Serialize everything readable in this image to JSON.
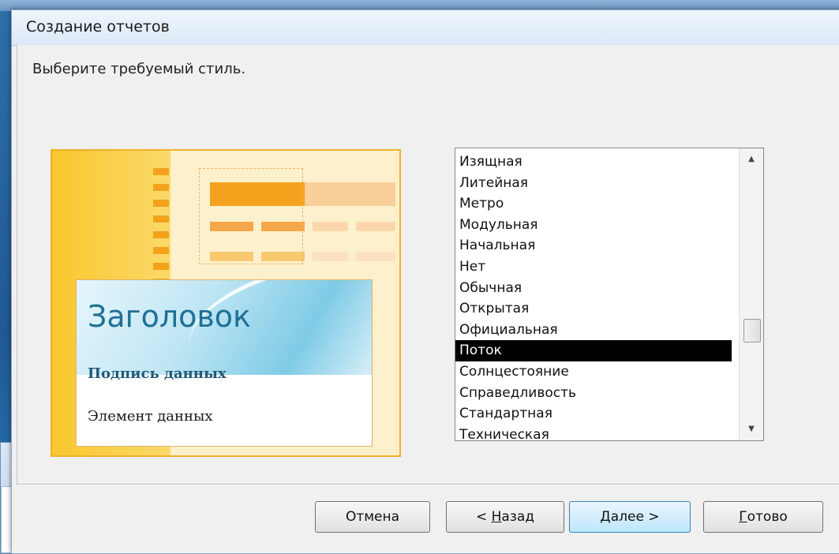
{
  "dialog": {
    "title": "Создание отчетов",
    "prompt": "Выберите требуемый стиль."
  },
  "preview": {
    "heading": "Заголовок",
    "caption": "Подпись данных",
    "item": "Элемент данных"
  },
  "style_list": {
    "items": [
      "Изящная",
      "Литейная",
      "Метро",
      "Модульная",
      "Начальная",
      "Нет",
      "Обычная",
      "Открытая",
      "Официальная",
      "Поток",
      "Солнцестояние",
      "Справедливость",
      "Стандартная",
      "Техническая"
    ],
    "selected": "Поток"
  },
  "buttons": {
    "cancel": "Отмена",
    "back_pre": "< ",
    "back_key": "Н",
    "back_post": "азад",
    "next_key": "Д",
    "next_post": "алее >",
    "finish_key": "Г",
    "finish_post": "отово"
  },
  "colors": {
    "accent_orange": "#f3a21c",
    "selection": "#000000",
    "heading_blue": "#1f6f95"
  }
}
